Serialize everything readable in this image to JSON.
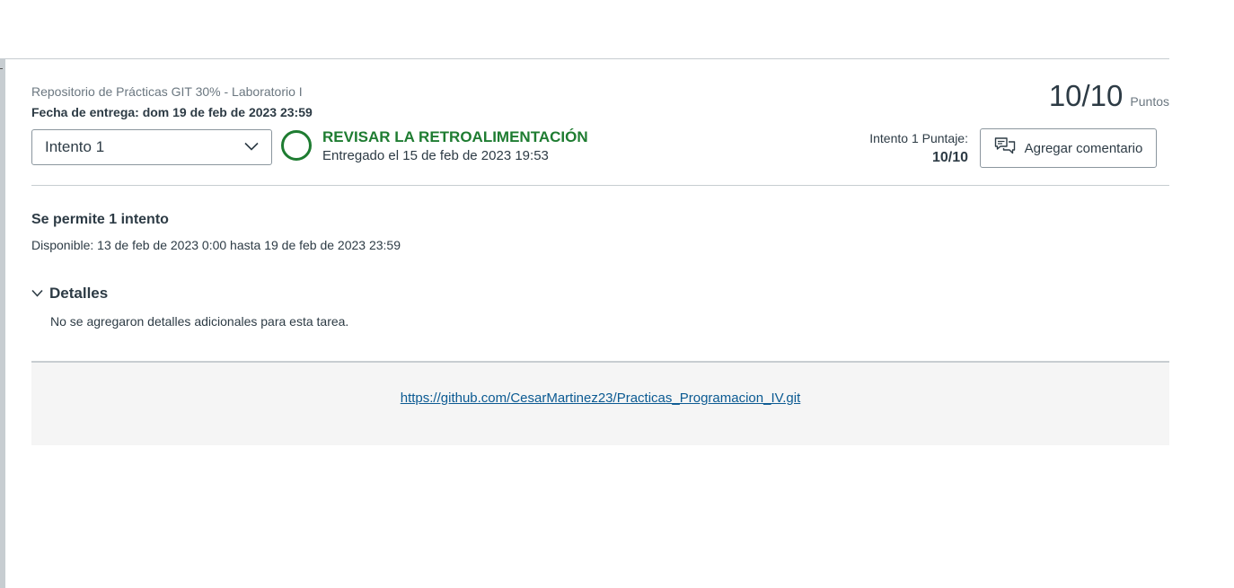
{
  "assignment": {
    "title": "Repositorio de Prácticas GIT 30% - Laboratorio I",
    "due_date": "Fecha de entrega: dom 19 de feb de 2023 23:59",
    "score": "10/10",
    "score_label": "Puntos"
  },
  "attempt": {
    "selected": "Intento 1",
    "status_label": "REVISAR LA RETROALIMENTACIÓN",
    "submitted_at": "Entregado el 15 de feb de 2023 19:53",
    "score_label": "Intento 1 Puntaje:",
    "score_value": "10/10",
    "comment_button": "Agregar comentario",
    "status_color": "#1e7c31"
  },
  "info": {
    "attempts_allowed": "Se permite 1 intento",
    "availability": "Disponible: 13 de feb de 2023 0:00 hasta 19 de feb de 2023 23:59"
  },
  "details": {
    "heading": "Detalles",
    "body": "No se agregaron detalles adicionales para esta tarea."
  },
  "submission": {
    "url": "https://github.com/CesarMartinez23/Practicas_Programacion_IV.git"
  },
  "icons": {
    "select": "chevron-down-icon",
    "comment": "comment-icon",
    "details": "chevron-down-icon",
    "status": "circle-status-icon"
  }
}
